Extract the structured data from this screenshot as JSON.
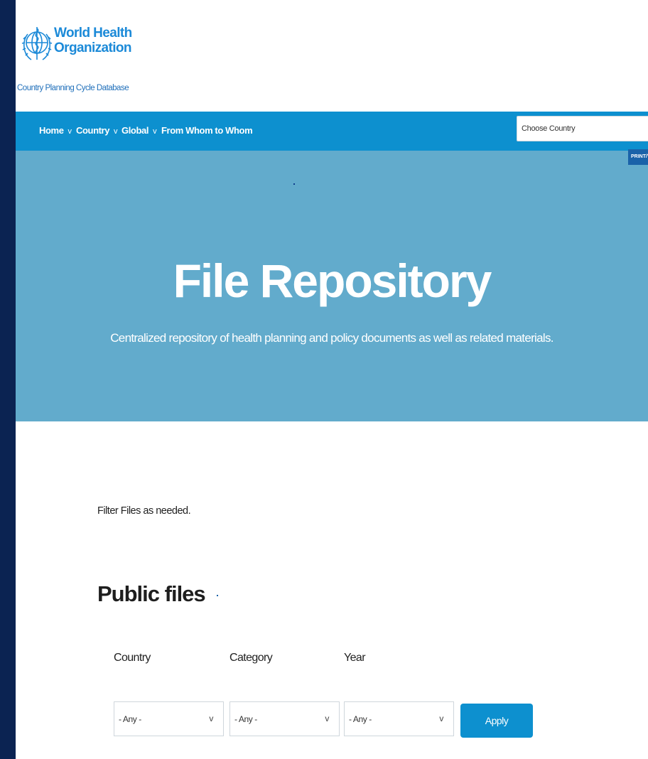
{
  "header": {
    "org_name": "World Health Organization",
    "db_name": "Country Planning Cycle Database"
  },
  "nav": {
    "items": [
      {
        "label": "Home",
        "dropdown": true
      },
      {
        "label": "Country",
        "dropdown": true
      },
      {
        "label": "Global",
        "dropdown": true
      },
      {
        "label": "From Whom to Whom",
        "dropdown": false
      }
    ],
    "chevron": "v",
    "country_placeholder": "Choose Country",
    "print_label": "PRINT/VIE"
  },
  "hero": {
    "title": "File Repository",
    "subtitle": "Centralized repository of health planning and policy documents as well as related materials."
  },
  "content": {
    "intro": "Filter Files as needed.",
    "section_title": "Public files"
  },
  "filters": {
    "country": {
      "label": "Country",
      "value": "- Any -"
    },
    "category": {
      "label": "Category",
      "value": "- Any -"
    },
    "year": {
      "label": "Year",
      "value": "- Any -"
    },
    "chevron": "v",
    "apply_label": "Apply"
  },
  "colors": {
    "nav_bg": "#0d90cf",
    "hero_bg": "#62abcc",
    "brand_blue": "#1c8ad8",
    "outer_bg": "#0d2252"
  }
}
